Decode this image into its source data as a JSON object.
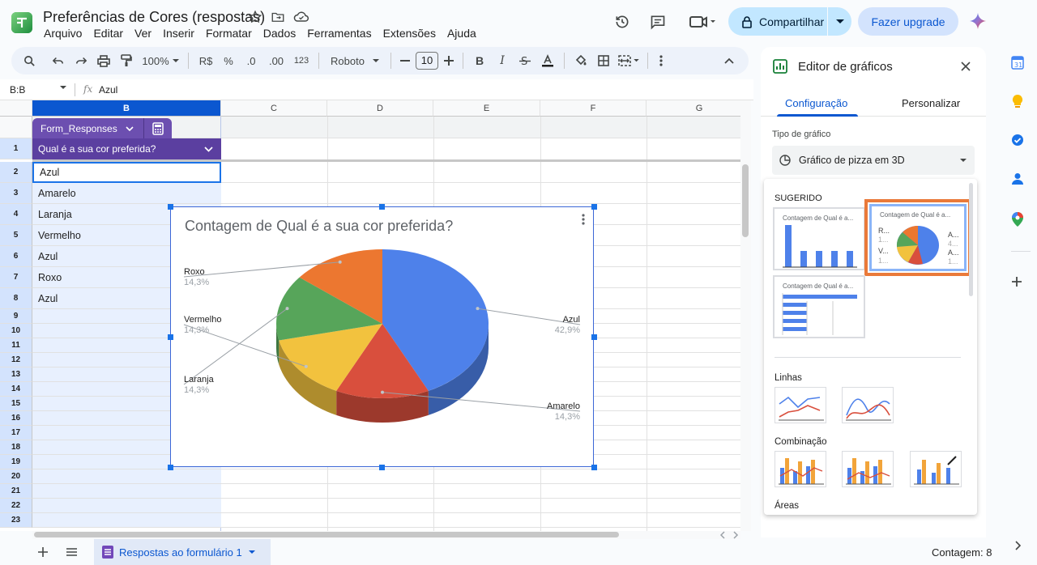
{
  "app": {
    "doc_title": "Preferências de Cores (respostas)",
    "menus": [
      "Arquivo",
      "Editar",
      "Ver",
      "Inserir",
      "Formatar",
      "Dados",
      "Ferramentas",
      "Extensões",
      "Ajuda"
    ],
    "share_label": "Compartilhar",
    "upgrade_label": "Fazer upgrade"
  },
  "toolbar": {
    "zoom": "100%",
    "currency": "R$",
    "percent": "%",
    "dec_less": ".0",
    "dec_more": ".00",
    "number_format": "123",
    "font": "Roboto",
    "font_size": "10"
  },
  "formula_bar": {
    "name_box": "B:B",
    "fx": "fx",
    "content": "Azul"
  },
  "grid": {
    "columns": [
      "B",
      "C",
      "D",
      "E",
      "F",
      "G"
    ],
    "rows": [
      "1",
      "2",
      "3",
      "4",
      "5",
      "6",
      "7",
      "8",
      "9",
      "10",
      "11",
      "12",
      "13",
      "14",
      "15",
      "16",
      "17",
      "18",
      "19",
      "20",
      "21",
      "22",
      "23"
    ],
    "table_name": "Form_Responses",
    "question_header": "Qual é a sua cor preferida?",
    "values": [
      "Azul",
      "Amarelo",
      "Laranja",
      "Vermelho",
      "Azul",
      "Roxo",
      "Azul"
    ]
  },
  "chart": {
    "title": "Contagem de Qual é a sua cor preferida?",
    "slice_labels": [
      {
        "label": "Roxo",
        "pct": "14,3%"
      },
      {
        "label": "Vermelho",
        "pct": "14,3%"
      },
      {
        "label": "Laranja",
        "pct": "14,3%"
      },
      {
        "label": "Azul",
        "pct": "42,9%"
      },
      {
        "label": "Amarelo",
        "pct": "14,3%"
      }
    ]
  },
  "chart_data": {
    "type": "pie",
    "title": "Contagem de Qual é a sua cor preferida?",
    "categories": [
      "Azul",
      "Amarelo",
      "Vermelho",
      "Laranja",
      "Roxo"
    ],
    "values": [
      3,
      1,
      1,
      1,
      1
    ],
    "percent_labels": [
      "42,9%",
      "14,3%",
      "14,3%",
      "14,3%",
      "14,3%"
    ],
    "colors": [
      "#4e81ea",
      "#d94f3d",
      "#f2c23e",
      "#57a55a",
      "#ec7730"
    ],
    "style": "3D"
  },
  "bottom": {
    "sheet_tab": "Respostas ao formulário 1",
    "status": "Contagem: 8"
  },
  "panel": {
    "title": "Editor de gráficos",
    "tab_setup": "Configuração",
    "tab_customize": "Personalizar",
    "chart_type_label": "Tipo de gráfico",
    "chart_type_value": "Gráfico de pizza em 3D",
    "section_suggested": "SUGERIDO",
    "suggested_thumb_title": "Contagem de Qual é a...",
    "section_lines": "Linhas",
    "section_combo": "Combinação",
    "section_areas": "Áreas",
    "thumb_pie_labels": [
      "R...",
      "1...",
      "V...",
      "1...",
      "A...",
      "4...",
      "A...",
      "1..."
    ]
  },
  "colors": {
    "accent": "#0b57d0",
    "selection": "#e8f0fe",
    "table_header": "#5b3fa0",
    "highlight_border": "#ea7a3a"
  }
}
